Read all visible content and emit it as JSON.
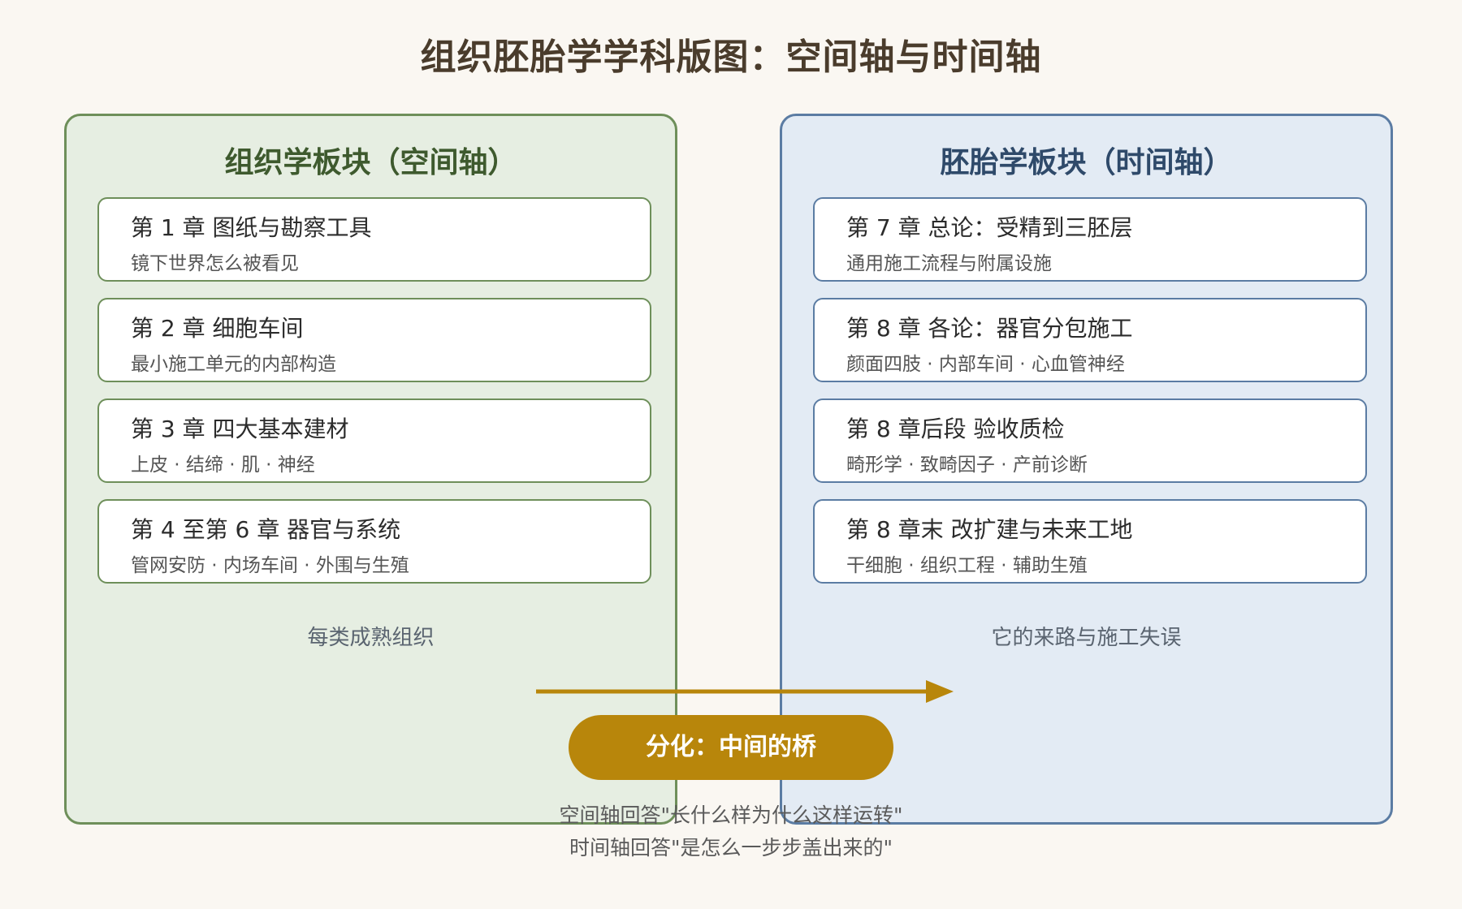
{
  "title": "组织胚胎学学科版图：空间轴与时间轴",
  "left_panel": {
    "title": "组织学板块（空间轴）",
    "cards": [
      {
        "title": "第 1 章 图纸与勘察工具",
        "subtitle": "镜下世界怎么被看见"
      },
      {
        "title": "第 2 章 细胞车间",
        "subtitle": "最小施工单元的内部构造"
      },
      {
        "title": "第 3 章 四大基本建材",
        "subtitle": "上皮 · 结缔 · 肌 · 神经"
      },
      {
        "title": "第 4 至第 6 章 器官与系统",
        "subtitle": "管网安防 · 内场车间 · 外围与生殖"
      }
    ],
    "footer": "每类成熟组织"
  },
  "right_panel": {
    "title": "胚胎学板块（时间轴）",
    "cards": [
      {
        "title": "第 7 章 总论：受精到三胚层",
        "subtitle": "通用施工流程与附属设施"
      },
      {
        "title": "第 8 章 各论：器官分包施工",
        "subtitle": "颜面四肢 · 内部车间 · 心血管神经"
      },
      {
        "title": "第 8 章后段 验收质检",
        "subtitle": "畸形学 · 致畸因子 · 产前诊断"
      },
      {
        "title": "第 8 章末 改扩建与未来工地",
        "subtitle": "干细胞 · 组织工程 · 辅助生殖"
      }
    ],
    "footer": "它的来路与施工失误"
  },
  "bridge": {
    "label": "分化：中间的桥",
    "note_line1": "空间轴回答\"长什么样为什么这样运转\"",
    "note_line2": "时间轴回答\"是怎么一步步盖出来的\""
  },
  "colors": {
    "left_accent": "#6e8f5a",
    "right_accent": "#5b7ca3",
    "bridge": "#b8860b"
  }
}
